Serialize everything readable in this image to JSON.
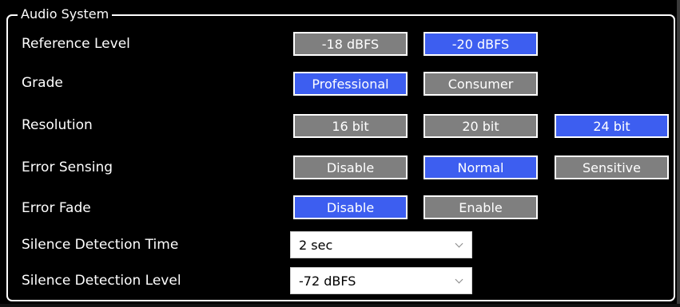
{
  "group": {
    "title": "Audio System"
  },
  "rows": [
    {
      "label": "Reference Level",
      "options": [
        "-18 dBFS",
        "-20 dBFS"
      ],
      "selected": 1
    },
    {
      "label": "Grade",
      "options": [
        "Professional",
        "Consumer"
      ],
      "selected": 0
    },
    {
      "label": "Resolution",
      "options": [
        "16 bit",
        "20 bit",
        "24 bit"
      ],
      "selected": 2
    },
    {
      "label": "Error Sensing",
      "options": [
        "Disable",
        "Normal",
        "Sensitive"
      ],
      "selected": 1
    },
    {
      "label": "Error Fade",
      "options": [
        "Disable",
        "Enable"
      ],
      "selected": 0
    }
  ],
  "dropdowns": [
    {
      "label": "Silence Detection Time",
      "value": "2 sec"
    },
    {
      "label": "Silence Detection Level",
      "value": "-72 dBFS"
    }
  ],
  "colors": {
    "active": "#3d5ef0",
    "inactive": "#7f7f7f",
    "background": "#000000"
  }
}
